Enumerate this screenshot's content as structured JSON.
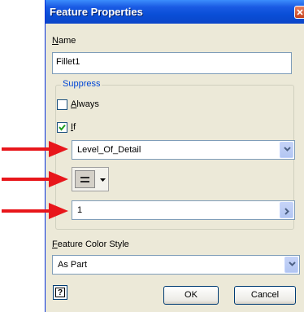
{
  "dialog": {
    "title": "Feature Properties",
    "name_label": "Name",
    "name_value": "Fillet1",
    "suppress_group": "Suppress",
    "always_label": "Always",
    "always_checked": false,
    "if_label": "If",
    "if_checked": true,
    "parameter_value": "Level_Of_Detail",
    "operator_value": "=",
    "condition_value": "1",
    "color_style_label": "Feature Color Style",
    "color_style_value": "As Part",
    "ok_label": "OK",
    "cancel_label": "Cancel",
    "help_icon": "help-icon"
  },
  "annotations": {
    "arrow_color": "#e8161b",
    "arrows": [
      "parameter",
      "operator",
      "value"
    ]
  }
}
